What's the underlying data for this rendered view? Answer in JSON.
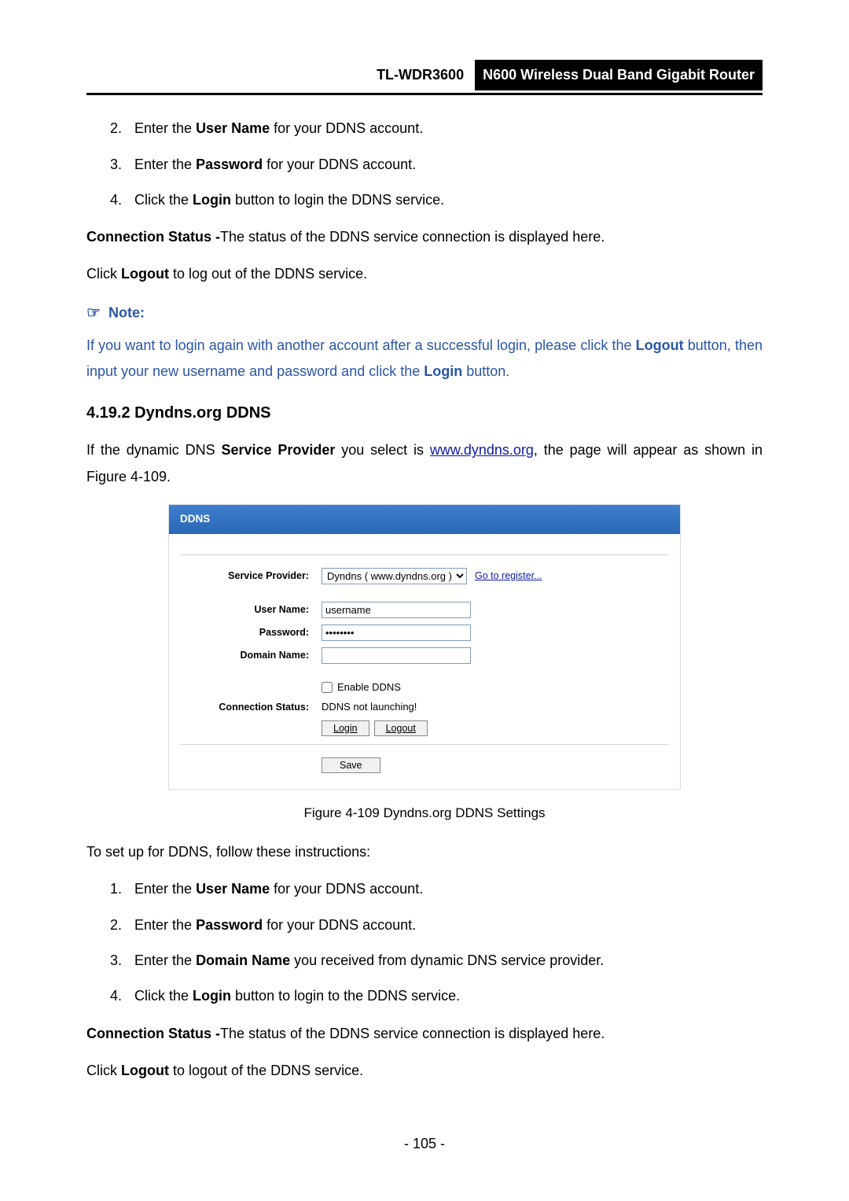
{
  "header": {
    "model": "TL-WDR3600",
    "desc": "N600 Wireless Dual Band Gigabit Router"
  },
  "top_list": {
    "items": [
      {
        "num": "2.",
        "pre": "Enter the ",
        "bold": "User Name",
        "post": " for your DDNS account."
      },
      {
        "num": "3.",
        "pre": "Enter the ",
        "bold": "Password",
        "post": " for your DDNS account."
      },
      {
        "num": "4.",
        "pre": "Click the ",
        "bold": "Login",
        "post": " button to login the DDNS service."
      }
    ]
  },
  "conn_status_para": {
    "bold": "Connection Status -",
    "rest": "The status of the DDNS service connection is displayed here."
  },
  "logout_para": {
    "pre": "Click ",
    "bold": "Logout",
    "post": " to log out of the DDNS service."
  },
  "note_label": "Note:",
  "note_text": {
    "seg1": " If you want to login again with another account after a successful login, please click the ",
    "b1": "Logout",
    "seg2": " button, then input your new username and password and click the ",
    "b2": "Login",
    "seg3": " button."
  },
  "section_heading": "4.19.2   Dyndns.org DDNS",
  "intro": {
    "seg1": "If the dynamic DNS ",
    "b1": "Service Provider",
    "seg2": " you select is ",
    "link": "www.dyndns.org",
    "seg3": ", the page will appear as shown in Figure 4-109."
  },
  "figure": {
    "title": "DDNS",
    "labels": {
      "service_provider": "Service Provider:",
      "user_name": "User Name:",
      "password": "Password:",
      "domain_name": "Domain Name:",
      "connection_status": "Connection Status:"
    },
    "service_value": "Dyndns ( www.dyndns.org )",
    "go_register": "Go to register...",
    "username_value": "username",
    "password_value": "••••••••",
    "domain_value": "",
    "enable_ddns": "Enable DDNS",
    "conn_status_value": "DDNS not launching!",
    "btn_login": "Login",
    "btn_logout": "Logout",
    "btn_save": "Save"
  },
  "caption": "Figure 4-109 Dyndns.org DDNS Settings",
  "setup_line": "To set up for DDNS, follow these instructions:",
  "bottom_list": {
    "items": [
      {
        "num": "1.",
        "pre": "Enter the ",
        "bold": "User Name",
        "post": " for your DDNS account."
      },
      {
        "num": "2.",
        "pre": "Enter the ",
        "bold": "Password",
        "post": " for your DDNS account."
      },
      {
        "num": "3.",
        "pre": "Enter the ",
        "bold": "Domain Name",
        "post": " you received from dynamic DNS service provider."
      },
      {
        "num": "4.",
        "pre": "Click the ",
        "bold": "Login",
        "post": " button to login to the DDNS service."
      }
    ]
  },
  "conn_status_para2": {
    "bold": "Connection Status -",
    "rest": "The status of the DDNS service connection is displayed here."
  },
  "logout_para2": {
    "pre": "Click ",
    "bold": "Logout",
    "post": " to logout of the DDNS service."
  },
  "page_number": "- 105 -"
}
